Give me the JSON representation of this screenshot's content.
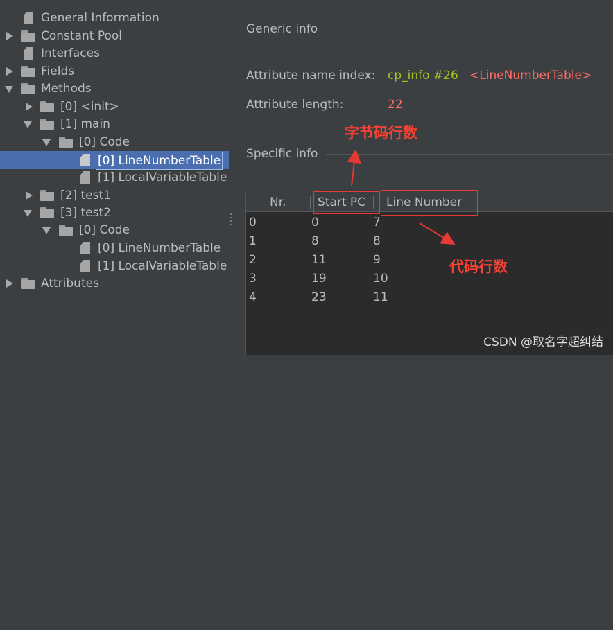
{
  "tree": {
    "items": [
      {
        "label": "General Information",
        "icon": "file-icon",
        "arrow": "none"
      },
      {
        "label": "Constant Pool",
        "icon": "folder-icon",
        "arrow": "collapsed"
      },
      {
        "label": "Interfaces",
        "icon": "file-icon",
        "arrow": "none"
      },
      {
        "label": "Fields",
        "icon": "folder-icon",
        "arrow": "collapsed"
      },
      {
        "label": "Methods",
        "icon": "folder-icon",
        "arrow": "expanded"
      },
      {
        "label": "[0] <init>",
        "icon": "folder-icon",
        "arrow": "collapsed"
      },
      {
        "label": "[1] main",
        "icon": "folder-icon",
        "arrow": "expanded"
      },
      {
        "label": "[0] Code",
        "icon": "folder-icon",
        "arrow": "expanded"
      },
      {
        "label": "[0] LineNumberTable",
        "icon": "file-icon",
        "arrow": "none",
        "selected": true
      },
      {
        "label": "[1] LocalVariableTable",
        "icon": "file-icon",
        "arrow": "none"
      },
      {
        "label": "[2] test1",
        "icon": "folder-icon",
        "arrow": "collapsed"
      },
      {
        "label": "[3] test2",
        "icon": "folder-icon",
        "arrow": "expanded"
      },
      {
        "label": "[0] Code",
        "icon": "folder-icon",
        "arrow": "expanded"
      },
      {
        "label": "[0] LineNumberTable",
        "icon": "file-icon",
        "arrow": "none"
      },
      {
        "label": "[1] LocalVariableTable",
        "icon": "file-icon",
        "arrow": "none"
      },
      {
        "label": "Attributes",
        "icon": "folder-icon",
        "arrow": "collapsed"
      }
    ]
  },
  "generic": {
    "title": "Generic info",
    "name_index_label": "Attribute name index:",
    "name_index_link": "cp_info #26",
    "name_index_value": "<LineNumberTable>",
    "length_label": "Attribute length:",
    "length_value": "22"
  },
  "specific": {
    "title": "Specific info",
    "columns": [
      "Nr.",
      "Start PC",
      "Line Number"
    ],
    "rows": [
      [
        "0",
        "0",
        "7"
      ],
      [
        "1",
        "8",
        "8"
      ],
      [
        "2",
        "11",
        "9"
      ],
      [
        "3",
        "19",
        "10"
      ],
      [
        "4",
        "23",
        "11"
      ]
    ]
  },
  "annotations": {
    "bytecode_rows": "字节码行数",
    "code_rows": "代码行数"
  },
  "watermark": "CSDN @取名字超纠结",
  "colors": {
    "background": "#3c3f41",
    "selection": "#4b6eaf",
    "link": "#a8c023",
    "value_red": "#ff6b68",
    "annotation_red": "#f44336"
  }
}
